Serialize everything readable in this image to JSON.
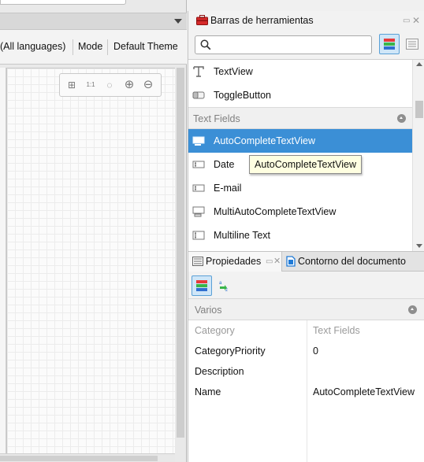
{
  "designer": {
    "languages_label": "(All languages)",
    "mode_label": "Mode",
    "theme_label": "Default Theme",
    "zoom_icons": [
      "layout-icon",
      "zoom-fit-icon",
      "zoom-reset-icon",
      "zoom-in-icon",
      "zoom-out-icon"
    ],
    "zoom_glyphs": [
      "⊞",
      "1:1",
      "◌",
      "⊕",
      "⊖"
    ]
  },
  "toolbox": {
    "title": "Barras de herramientas",
    "search_value": "",
    "search_placeholder": "",
    "items_top": [
      {
        "label": "TextView",
        "icon": "textview-icon"
      },
      {
        "label": "ToggleButton",
        "icon": "togglebutton-icon"
      }
    ],
    "section": "Text Fields",
    "items_text": [
      {
        "label": "AutoCompleteTextView",
        "icon": "autocomplete-icon",
        "selected": true
      },
      {
        "label": "Date",
        "icon": "date-field-icon"
      },
      {
        "label": "E-mail",
        "icon": "email-field-icon"
      },
      {
        "label": "MultiAutoCompleteTextView",
        "icon": "multiautocomplete-icon"
      },
      {
        "label": "Multiline Text",
        "icon": "multiline-text-icon"
      }
    ],
    "tooltip": "AutoCompleteTextView"
  },
  "properties": {
    "tab_properties": "Propiedades",
    "tab_outline": "Contorno del documento",
    "group": "Varios",
    "rows": [
      {
        "key": "Category",
        "value": "Text Fields",
        "dim": true
      },
      {
        "key": "CategoryPriority",
        "value": "0"
      },
      {
        "key": "Description",
        "value": ""
      },
      {
        "key": "Name",
        "value": "AutoCompleteTextView"
      }
    ]
  },
  "colors": {
    "selection": "#3b8fd6",
    "tooltip_bg": "#ffffe1",
    "toggle_active": "#cfe6f8"
  }
}
